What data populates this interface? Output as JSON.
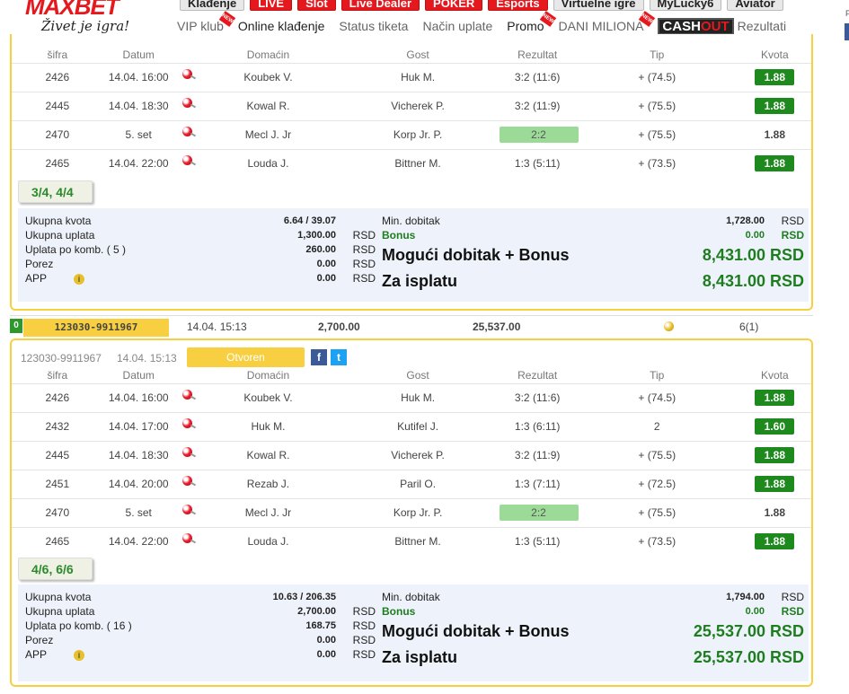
{
  "brand": {
    "name": "MAXBET",
    "slogan": "Živet je igra!"
  },
  "nav_top": [
    {
      "label": "Klađenje",
      "style": "grey"
    },
    {
      "label": "LIVE",
      "style": "red"
    },
    {
      "label": "Slot",
      "style": "red"
    },
    {
      "label": "Live Dealer",
      "style": "red"
    },
    {
      "label": "POKER",
      "style": "red"
    },
    {
      "label": "Esports",
      "style": "red"
    },
    {
      "label": "Virtuelne igre",
      "style": "grey"
    },
    {
      "label": "MyLucky6",
      "style": "grey"
    },
    {
      "label": "Aviator",
      "style": "grey"
    }
  ],
  "nav_sub": {
    "vip": "VIP klub",
    "online": "Online klađenje",
    "status": "Status tiketa",
    "payment": "Način uplate",
    "promo": "Promo",
    "dani": "DANI MILIONA",
    "cashout_a": "CASH",
    "cashout_b": "OUT",
    "results": "Rezultati",
    "new_tag": "NEW"
  },
  "right_stub": "F",
  "columns": [
    "šifra",
    "Datum",
    "",
    "Domaćin",
    "Gost",
    "Rezultat",
    "Tip",
    "Kvota"
  ],
  "ticket1": {
    "rows": [
      {
        "code": "2426",
        "date": "14.04. 16:00",
        "home": "Koubek V.",
        "away": "Huk M.",
        "result": "3:2 (11:6)",
        "tip": "+ (74.5)",
        "odd": "1.88",
        "result_hl": false,
        "odd_hl": true
      },
      {
        "code": "2445",
        "date": "14.04. 18:30",
        "home": "Kowal R.",
        "away": "Vicherek P.",
        "result": "3:2 (11:9)",
        "tip": "+ (75.5)",
        "odd": "1.88",
        "result_hl": false,
        "odd_hl": true
      },
      {
        "code": "2470",
        "date": "5. set",
        "home": "Mecl J. Jr",
        "away": "Korp Jr. P.",
        "result": "2:2",
        "tip": "+ (75.5)",
        "odd": "1.88",
        "result_hl": true,
        "odd_hl": false
      },
      {
        "code": "2465",
        "date": "14.04. 22:00",
        "home": "Louda J.",
        "away": "Bittner M.",
        "result": "1:3 (5:11)",
        "tip": "+ (73.5)",
        "odd": "1.88",
        "result_hl": false,
        "odd_hl": true
      }
    ],
    "combo": "3/4, 4/4",
    "summary": {
      "ukupna_kvota_label": "Ukupna kvota",
      "ukupna_kvota": "6.64 / 39.07",
      "ukupna_uplata_label": "Ukupna uplata",
      "ukupna_uplata": "1,300.00",
      "uplata_komb_label": "Uplata po komb. ( 5 )",
      "uplata_komb": "260.00",
      "porez_label": "Porez",
      "porez": "0.00",
      "app_label": "APP",
      "app": "0.00",
      "currency": "RSD",
      "min_label": "Min. dobitak",
      "min": "1,728.00",
      "bonus_label": "Bonus",
      "bonus": "0.00",
      "mogući_label": "Mogući dobitak + Bonus",
      "mogući": "8,431.00 RSD",
      "isplata_label": "Za isplatu",
      "isplata": "8,431.00 RSD"
    }
  },
  "separator": {
    "badge": "0",
    "id": "123030-9911967",
    "datetime": "14.04. 15:13",
    "stake": "2,700.00",
    "win": "25,537.00",
    "count": "6(1)"
  },
  "ticket2": {
    "id": "123030-9911967",
    "datetime": "14.04. 15:13",
    "status": "Otvoren",
    "rows": [
      {
        "code": "2426",
        "date": "14.04. 16:00",
        "home": "Koubek V.",
        "away": "Huk M.",
        "result": "3:2 (11:6)",
        "tip": "+ (74.5)",
        "odd": "1.88",
        "result_hl": false,
        "odd_hl": true
      },
      {
        "code": "2432",
        "date": "14.04. 17:00",
        "home": "Huk M.",
        "away": "Kutifel J.",
        "result": "1:3 (6:11)",
        "tip": "2",
        "odd": "1.60",
        "result_hl": false,
        "odd_hl": true
      },
      {
        "code": "2445",
        "date": "14.04. 18:30",
        "home": "Kowal R.",
        "away": "Vicherek P.",
        "result": "3:2 (11:9)",
        "tip": "+ (75.5)",
        "odd": "1.88",
        "result_hl": false,
        "odd_hl": true
      },
      {
        "code": "2451",
        "date": "14.04. 20:00",
        "home": "Rezab J.",
        "away": "Paril O.",
        "result": "1:3 (7:11)",
        "tip": "+ (72.5)",
        "odd": "1.88",
        "result_hl": false,
        "odd_hl": true
      },
      {
        "code": "2470",
        "date": "5. set",
        "home": "Mecl J. Jr",
        "away": "Korp Jr. P.",
        "result": "2:2",
        "tip": "+ (75.5)",
        "odd": "1.88",
        "result_hl": true,
        "odd_hl": false
      },
      {
        "code": "2465",
        "date": "14.04. 22:00",
        "home": "Louda J.",
        "away": "Bittner M.",
        "result": "1:3 (5:11)",
        "tip": "+ (73.5)",
        "odd": "1.88",
        "result_hl": false,
        "odd_hl": true
      }
    ],
    "combo": "4/6, 6/6",
    "summary": {
      "ukupna_kvota_label": "Ukupna kvota",
      "ukupna_kvota": "10.63 / 206.35",
      "ukupna_uplata_label": "Ukupna uplata",
      "ukupna_uplata": "2,700.00",
      "uplata_komb_label": "Uplata po komb. ( 16 )",
      "uplata_komb": "168.75",
      "porez_label": "Porez",
      "porez": "0.00",
      "app_label": "APP",
      "app": "0.00",
      "currency": "RSD",
      "min_label": "Min. dobitak",
      "min": "1,794.00",
      "bonus_label": "Bonus",
      "bonus": "0.00",
      "mogući_label": "Mogući dobitak + Bonus",
      "mogući": "25,537.00 RSD",
      "isplata_label": "Za isplatu",
      "isplata": "25,537.00 RSD"
    }
  },
  "colors": {
    "accent_yellow": "#f7cf40",
    "odd_green": "#1e8a1e",
    "brand_red": "#e4181d"
  }
}
